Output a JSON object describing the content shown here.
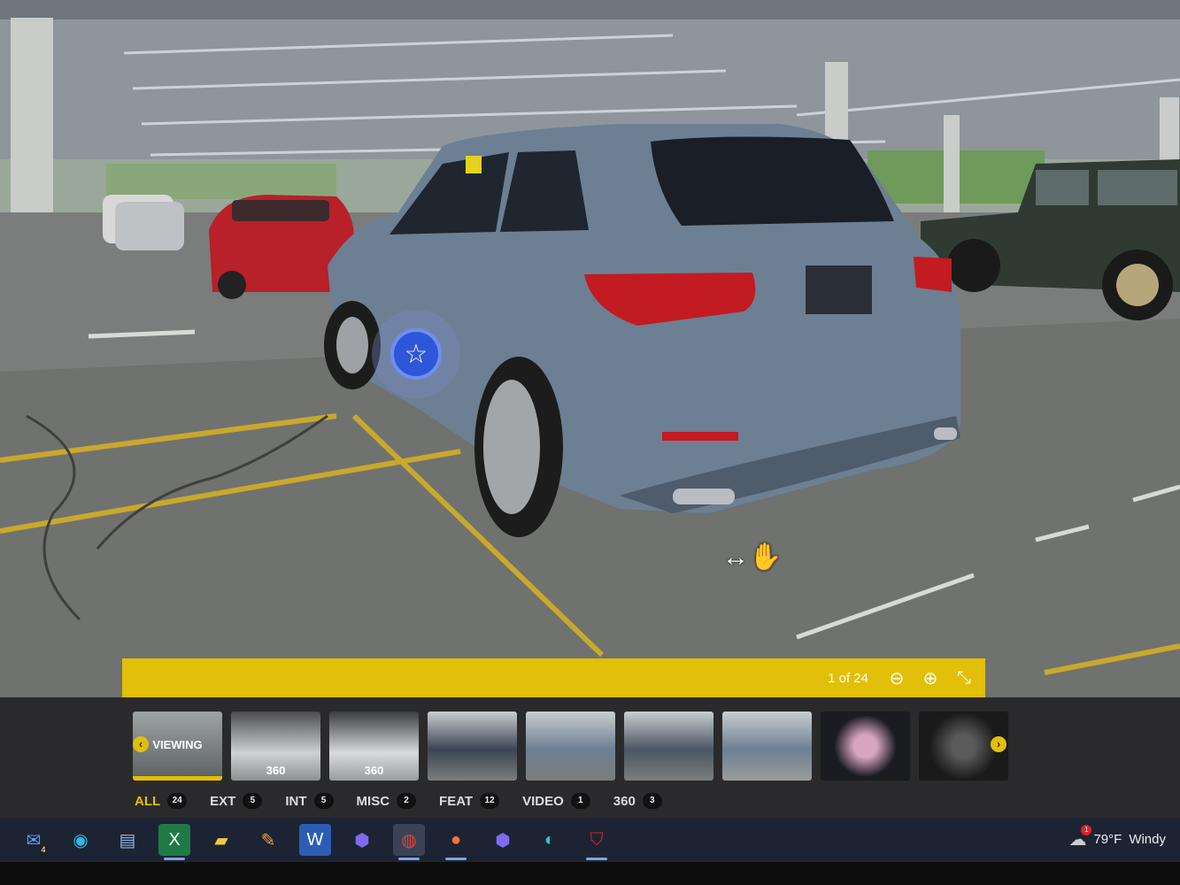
{
  "viewer": {
    "counter_text": "1 of 24",
    "zoom_out_icon": "zoom-out-icon",
    "zoom_in_icon": "zoom-in-icon",
    "exit_fullscreen_icon": "exit-fullscreen-icon",
    "hotspot_icon": "star-icon",
    "cursor_icon": "hand-pan-cursor-icon"
  },
  "thumbnails": [
    {
      "label": "VIEWING",
      "active": true
    },
    {
      "label": "360",
      "active": false
    },
    {
      "label": "360",
      "active": false
    },
    {
      "label": "",
      "active": false
    },
    {
      "label": "",
      "active": false
    },
    {
      "label": "",
      "active": false
    },
    {
      "label": "",
      "active": false
    },
    {
      "label": "",
      "active": false
    },
    {
      "label": "",
      "active": false
    }
  ],
  "filters": [
    {
      "label": "ALL",
      "count": "24",
      "active": true
    },
    {
      "label": "EXT",
      "count": "5",
      "active": false
    },
    {
      "label": "INT",
      "count": "5",
      "active": false
    },
    {
      "label": "MISC",
      "count": "2",
      "active": false
    },
    {
      "label": "FEAT",
      "count": "12",
      "active": false
    },
    {
      "label": "VIDEO",
      "count": "1",
      "active": false
    },
    {
      "label": "360",
      "count": "3",
      "active": false
    }
  ],
  "taskbar": {
    "mail_badge": "4",
    "apps": [
      "mail-icon",
      "edge-icon",
      "control-panel-icon",
      "excel-icon",
      "file-explorer-icon",
      "paint-icon",
      "word-icon",
      "copilot-icon",
      "chrome-icon",
      "firefox-icon",
      "copilot-alt-icon",
      "edge-dev-icon",
      "mcafee-icon"
    ],
    "weather_temp": "79°F",
    "weather_desc": "Windy",
    "weather_alert": "1"
  },
  "colors": {
    "accent_yellow": "#e2bf08",
    "car_body": "#6d7f93",
    "hotspot_blue": "#2f56d8"
  }
}
